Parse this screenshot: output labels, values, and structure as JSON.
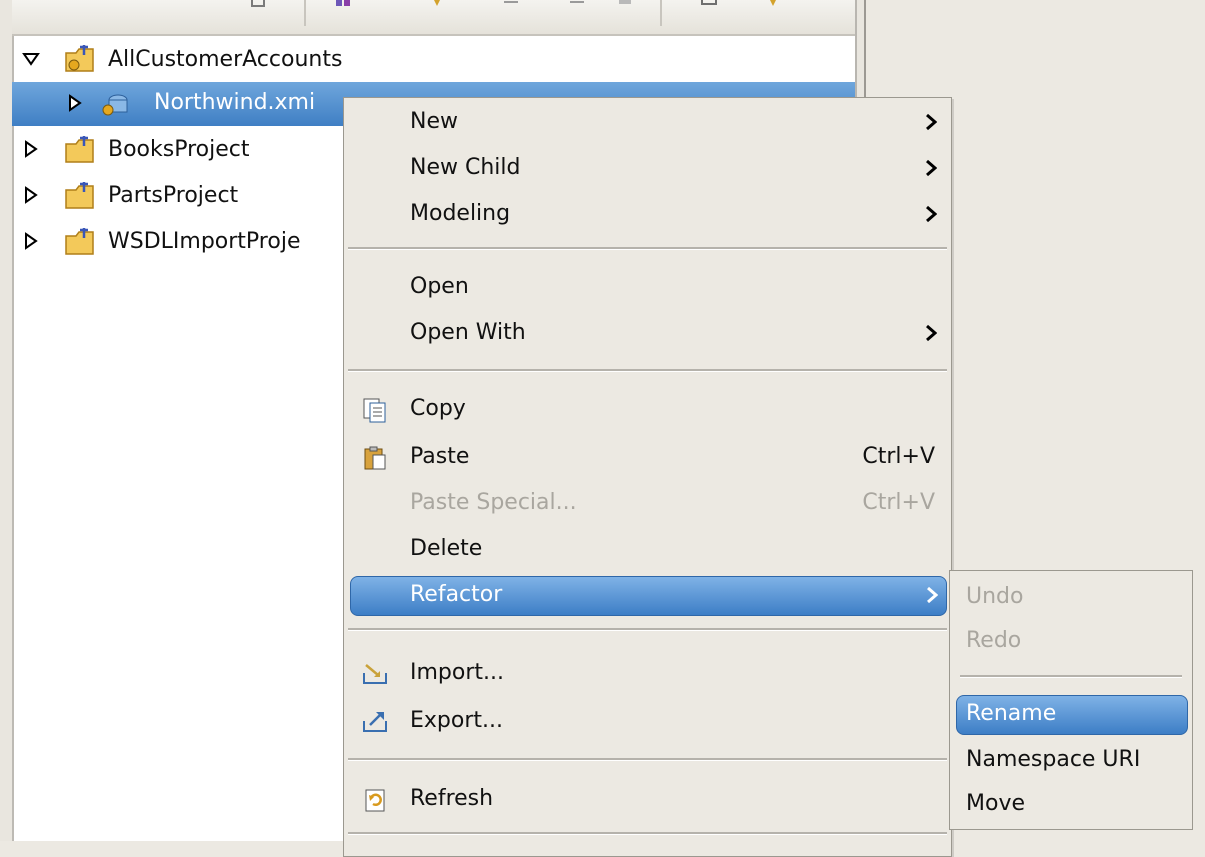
{
  "tree": {
    "items": [
      {
        "label": "AllCustomerAccounts",
        "expanded": true
      },
      {
        "label": "Northwind.xmi",
        "selected": true
      },
      {
        "label": "BooksProject",
        "expanded": false
      },
      {
        "label": "PartsProject",
        "expanded": false
      },
      {
        "label": "WSDLImportProje",
        "expanded": false
      }
    ]
  },
  "context_menu": {
    "new": "New",
    "new_child": "New Child",
    "modeling": "Modeling",
    "open": "Open",
    "open_with": "Open With",
    "copy": "Copy",
    "paste": "Paste",
    "paste_shortcut": "Ctrl+V",
    "paste_special": "Paste Special...",
    "paste_special_shortcut": "Ctrl+V",
    "delete": "Delete",
    "refactor": "Refactor",
    "import": "Import...",
    "export": "Export...",
    "refresh": "Refresh"
  },
  "refactor_submenu": {
    "undo": "Undo",
    "redo": "Redo",
    "rename": "Rename",
    "namespace_uri": "Namespace URI",
    "move": "Move"
  },
  "colors": {
    "highlight": "#3d7ec6",
    "menu_bg": "#ece9e2",
    "disabled_text": "#a9a69f"
  }
}
